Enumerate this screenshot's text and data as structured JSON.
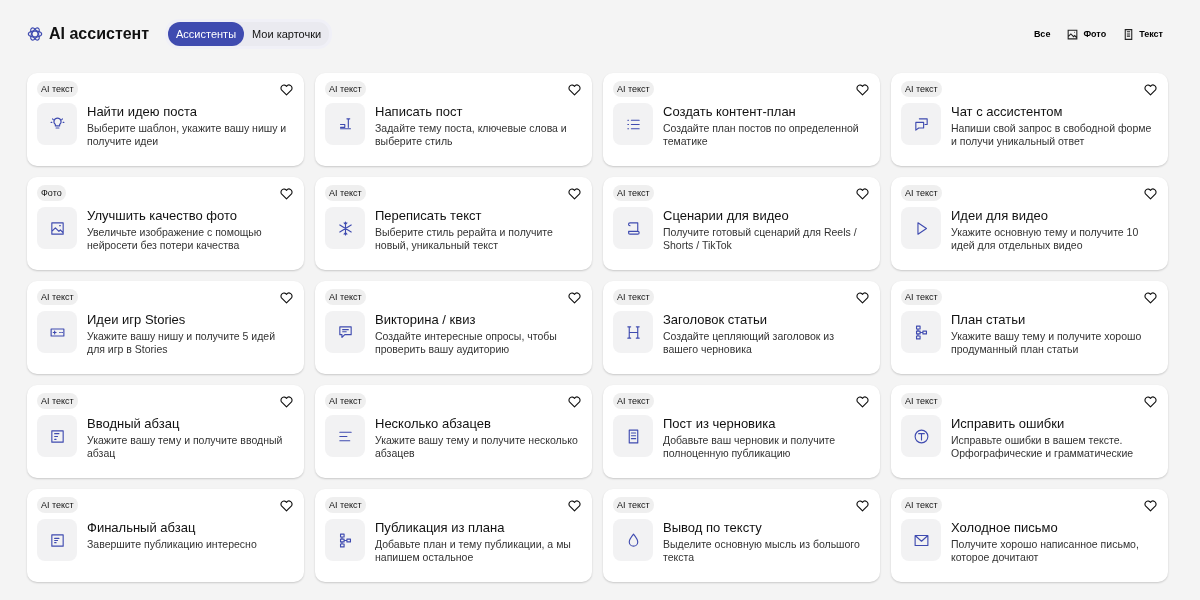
{
  "header": {
    "title": "AI ассистент"
  },
  "tabs": [
    {
      "label": "Ассистенты",
      "selected": true
    },
    {
      "label": "Мои карточки",
      "selected": false
    }
  ],
  "filters": [
    {
      "label": "Все",
      "kind": "all"
    },
    {
      "label": "Фото",
      "kind": "photo"
    },
    {
      "label": "Текст",
      "kind": "text"
    }
  ],
  "cards": [
    {
      "tag": "AI текст",
      "title": "Найти идею поста",
      "description": "Выберите шаблон, укажите вашу нишу и получите идеи",
      "favorite": false
    },
    {
      "tag": "AI текст",
      "title": "Написать пост",
      "description": "Задайте тему поста, ключевые слова и выберите стиль",
      "favorite": false
    },
    {
      "tag": "AI текст",
      "title": "Создать контент-план",
      "description": "Создайте план постов по определенной тематике",
      "favorite": false
    },
    {
      "tag": "AI текст",
      "title": "Чат с ассистентом",
      "description": "Напиши свой запрос в свободной форме и получи уникальный ответ",
      "favorite": false
    },
    {
      "tag": "Фото",
      "title": "Улучшить качество фото",
      "description": "Увеличьте изображение с помощью нейросети без потери качества",
      "favorite": false
    },
    {
      "tag": "AI текст",
      "title": "Переписать текст",
      "description": "Выберите стиль рерайта и получите новый, уникальный текст",
      "favorite": false
    },
    {
      "tag": "AI текст",
      "title": "Сценарии для видео",
      "description": "Получите готовый сценарий для Reels / Shorts / TikTok",
      "favorite": false
    },
    {
      "tag": "AI текст",
      "title": "Идеи для видео",
      "description": "Укажите основную тему и получите 10 идей для отдельных видео",
      "favorite": false
    },
    {
      "tag": "AI текст",
      "title": "Идеи игр Stories",
      "description": "Укажите вашу нишу и получите 5 идей для игр в Stories",
      "favorite": false
    },
    {
      "tag": "AI текст",
      "title": "Викторина / квиз",
      "description": "Создайте интересные опросы, чтобы проверить вашу аудиторию",
      "favorite": false
    },
    {
      "tag": "AI текст",
      "title": "Заголовок статьи",
      "description": "Создайте цепляющий заголовок из вашего черновика",
      "favorite": false
    },
    {
      "tag": "AI текст",
      "title": "План статьи",
      "description": "Укажите вашу тему и получите хорошо продуманный план статьи",
      "favorite": false
    },
    {
      "tag": "AI текст",
      "title": "Вводный абзац",
      "description": "Укажите вашу тему и получите вводный абзац",
      "favorite": false
    },
    {
      "tag": "AI текст",
      "title": "Несколько абзацев",
      "description": "Укажите вашу тему и получите несколько абзацев",
      "favorite": false
    },
    {
      "tag": "AI текст",
      "title": "Пост из черновика",
      "description": "Добавьте ваш черновик и получите полноценную публикацию",
      "favorite": false
    },
    {
      "tag": "AI текст",
      "title": "Исправить ошибки",
      "description": "Исправьте ошибки в вашем тексте. Орфографические и грамматические",
      "favorite": false
    },
    {
      "tag": "AI текст",
      "title": "Финальный абзац",
      "description": "Завершите публикацию интересно",
      "favorite": false
    },
    {
      "tag": "AI текст",
      "title": "Публикация из плана",
      "description": "Добавьте план и тему публикации, а мы напишем остальное",
      "favorite": false
    },
    {
      "tag": "AI текст",
      "title": "Вывод по тексту",
      "description": "Выделите основную мысль из большого текста",
      "favorite": false
    },
    {
      "tag": "AI текст",
      "title": "Холодное письмо",
      "description": "Получите хорошо написанное письмо, которое дочитают",
      "favorite": false
    }
  ]
}
